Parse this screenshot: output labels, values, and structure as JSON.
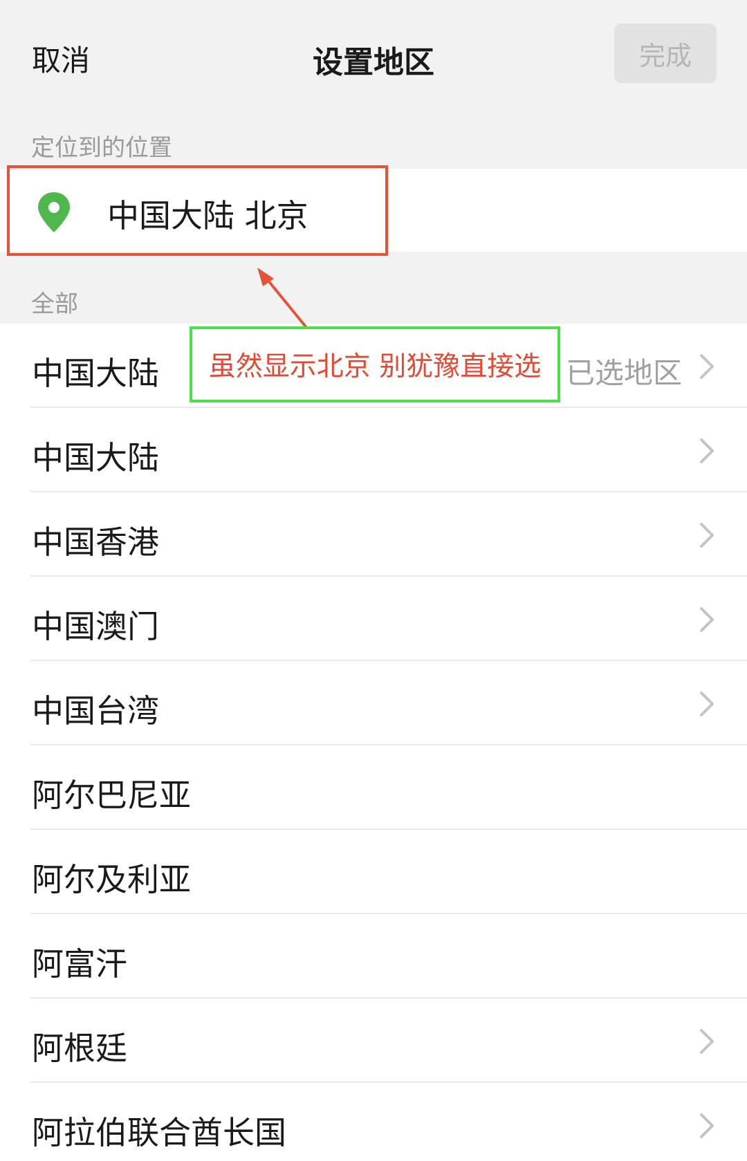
{
  "header": {
    "cancel_label": "取消",
    "title": "设置地区",
    "done_label": "完成"
  },
  "located": {
    "section_label": "定位到的位置",
    "icon": "location-pin-icon",
    "value": "中国大陆 北京"
  },
  "all": {
    "section_label": "全部",
    "selected_hint": "已选地区",
    "items": [
      {
        "label": "中国大陆",
        "chevron": true,
        "selected": true
      },
      {
        "label": "中国大陆",
        "chevron": true
      },
      {
        "label": "中国香港",
        "chevron": true
      },
      {
        "label": "中国澳门",
        "chevron": true
      },
      {
        "label": "中国台湾",
        "chevron": true
      },
      {
        "label": "阿尔巴尼亚",
        "chevron": false
      },
      {
        "label": "阿尔及利亚",
        "chevron": false
      },
      {
        "label": "阿富汗",
        "chevron": false
      },
      {
        "label": "阿根廷",
        "chevron": true
      },
      {
        "label": "阿拉伯联合酋长国",
        "chevron": true
      }
    ]
  },
  "annotation": {
    "note": "虽然显示北京 别犹豫直接选",
    "box_color": "#e2533a",
    "note_border_color": "#4be04b",
    "note_text_color": "#e24a34"
  },
  "colors": {
    "background": "#f2f2f2",
    "pin_green": "#4fb84d",
    "chevron": "#c4c4c4"
  }
}
